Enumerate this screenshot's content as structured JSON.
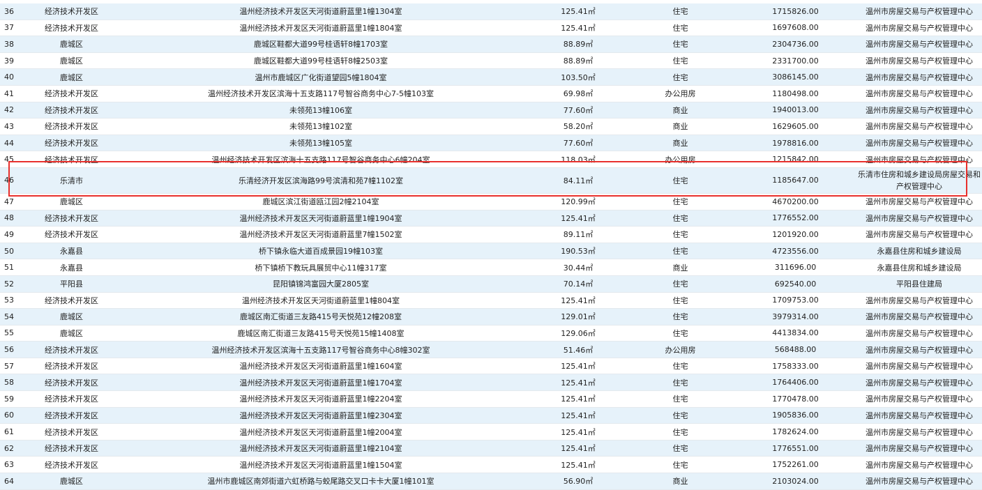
{
  "table": {
    "rows": [
      {
        "no": "36",
        "district": "经济技术开发区",
        "address": "温州经济技术开发区天河街道蔚蓝里1幢1304室",
        "area": "125.41㎡",
        "use": "住宅",
        "price": "1715826.00",
        "org": "温州市房屋交易与产权管理中心"
      },
      {
        "no": "37",
        "district": "经济技术开发区",
        "address": "温州经济技术开发区天河街道蔚蓝里1幢1804室",
        "area": "125.41㎡",
        "use": "住宅",
        "price": "1697608.00",
        "org": "温州市房屋交易与产权管理中心"
      },
      {
        "no": "38",
        "district": "鹿城区",
        "address": "鹿城区鞋都大道99号桂语轩8幢1703室",
        "area": "88.89㎡",
        "use": "住宅",
        "price": "2304736.00",
        "org": "温州市房屋交易与产权管理中心"
      },
      {
        "no": "39",
        "district": "鹿城区",
        "address": "鹿城区鞋都大道99号桂语轩8幢2503室",
        "area": "88.89㎡",
        "use": "住宅",
        "price": "2331700.00",
        "org": "温州市房屋交易与产权管理中心"
      },
      {
        "no": "40",
        "district": "鹿城区",
        "address": "温州市鹿城区广化街道望园5幢1804室",
        "area": "103.50㎡",
        "use": "住宅",
        "price": "3086145.00",
        "org": "温州市房屋交易与产权管理中心"
      },
      {
        "no": "41",
        "district": "经济技术开发区",
        "address": "温州经济技术开发区滨海十五支路117号智谷商务中心7-5幢103室",
        "area": "69.98㎡",
        "use": "办公用房",
        "price": "1180498.00",
        "org": "温州市房屋交易与产权管理中心"
      },
      {
        "no": "42",
        "district": "经济技术开发区",
        "address": "未领苑13幢106室",
        "area": "77.60㎡",
        "use": "商业",
        "price": "1940013.00",
        "org": "温州市房屋交易与产权管理中心"
      },
      {
        "no": "43",
        "district": "经济技术开发区",
        "address": "未领苑13幢102室",
        "area": "58.20㎡",
        "use": "商业",
        "price": "1629605.00",
        "org": "温州市房屋交易与产权管理中心"
      },
      {
        "no": "44",
        "district": "经济技术开发区",
        "address": "未领苑13幢105室",
        "area": "77.60㎡",
        "use": "商业",
        "price": "1978816.00",
        "org": "温州市房屋交易与产权管理中心"
      },
      {
        "no": "45",
        "district": "经济技术开发区",
        "address": "温州经济技术开发区滨海十五支路117号智谷商务中心6幢204室",
        "area": "118.03㎡",
        "use": "办公用房",
        "price": "1215842.00",
        "org": "温州市房屋交易与产权管理中心"
      },
      {
        "no": "46",
        "district": "乐清市",
        "address": "乐清经济开发区滨海路99号滨清和苑7幢1102室",
        "area": "84.11㎡",
        "use": "住宅",
        "price": "1185647.00",
        "org": "乐清市住房和城乡建设局房屋交易和产权管理中心"
      },
      {
        "no": "47",
        "district": "鹿城区",
        "address": "鹿城区滨江街道瓯江园2幢2104室",
        "area": "120.99㎡",
        "use": "住宅",
        "price": "4670200.00",
        "org": "温州市房屋交易与产权管理中心"
      },
      {
        "no": "48",
        "district": "经济技术开发区",
        "address": "温州经济技术开发区天河街道蔚蓝里1幢1904室",
        "area": "125.41㎡",
        "use": "住宅",
        "price": "1776552.00",
        "org": "温州市房屋交易与产权管理中心"
      },
      {
        "no": "49",
        "district": "经济技术开发区",
        "address": "温州经济技术开发区天河街道蔚蓝里7幢1502室",
        "area": "89.11㎡",
        "use": "住宅",
        "price": "1201920.00",
        "org": "温州市房屋交易与产权管理中心"
      },
      {
        "no": "50",
        "district": "永嘉县",
        "address": "桥下镇永临大道百成景园19幢103室",
        "area": "190.53㎡",
        "use": "住宅",
        "price": "4723556.00",
        "org": "永嘉县住房和城乡建设局"
      },
      {
        "no": "51",
        "district": "永嘉县",
        "address": "桥下镇桥下教玩具展贸中心11幢317室",
        "area": "30.44㎡",
        "use": "商业",
        "price": "311696.00",
        "org": "永嘉县住房和城乡建设局"
      },
      {
        "no": "52",
        "district": "平阳县",
        "address": "昆阳镇锦鸿富园大厦2805室",
        "area": "70.14㎡",
        "use": "住宅",
        "price": "692540.00",
        "org": "平阳县住建局"
      },
      {
        "no": "53",
        "district": "经济技术开发区",
        "address": "温州经济技术开发区天河街道蔚蓝里1幢804室",
        "area": "125.41㎡",
        "use": "住宅",
        "price": "1709753.00",
        "org": "温州市房屋交易与产权管理中心"
      },
      {
        "no": "54",
        "district": "鹿城区",
        "address": "鹿城区南汇街道三友路415号天悦苑12幢208室",
        "area": "129.01㎡",
        "use": "住宅",
        "price": "3979314.00",
        "org": "温州市房屋交易与产权管理中心"
      },
      {
        "no": "55",
        "district": "鹿城区",
        "address": "鹿城区南汇街道三友路415号天悦苑15幢1408室",
        "area": "129.06㎡",
        "use": "住宅",
        "price": "4413834.00",
        "org": "温州市房屋交易与产权管理中心"
      },
      {
        "no": "56",
        "district": "经济技术开发区",
        "address": "温州经济技术开发区滨海十五支路117号智谷商务中心8幢302室",
        "area": "51.46㎡",
        "use": "办公用房",
        "price": "568488.00",
        "org": "温州市房屋交易与产权管理中心"
      },
      {
        "no": "57",
        "district": "经济技术开发区",
        "address": "温州经济技术开发区天河街道蔚蓝里1幢1604室",
        "area": "125.41㎡",
        "use": "住宅",
        "price": "1758333.00",
        "org": "温州市房屋交易与产权管理中心"
      },
      {
        "no": "58",
        "district": "经济技术开发区",
        "address": "温州经济技术开发区天河街道蔚蓝里1幢1704室",
        "area": "125.41㎡",
        "use": "住宅",
        "price": "1764406.00",
        "org": "温州市房屋交易与产权管理中心"
      },
      {
        "no": "59",
        "district": "经济技术开发区",
        "address": "温州经济技术开发区天河街道蔚蓝里1幢2204室",
        "area": "125.41㎡",
        "use": "住宅",
        "price": "1770478.00",
        "org": "温州市房屋交易与产权管理中心"
      },
      {
        "no": "60",
        "district": "经济技术开发区",
        "address": "温州经济技术开发区天河街道蔚蓝里1幢2304室",
        "area": "125.41㎡",
        "use": "住宅",
        "price": "1905836.00",
        "org": "温州市房屋交易与产权管理中心"
      },
      {
        "no": "61",
        "district": "经济技术开发区",
        "address": "温州经济技术开发区天河街道蔚蓝里1幢2004室",
        "area": "125.41㎡",
        "use": "住宅",
        "price": "1782624.00",
        "org": "温州市房屋交易与产权管理中心"
      },
      {
        "no": "62",
        "district": "经济技术开发区",
        "address": "温州经济技术开发区天河街道蔚蓝里1幢2104室",
        "area": "125.41㎡",
        "use": "住宅",
        "price": "1776551.00",
        "org": "温州市房屋交易与产权管理中心"
      },
      {
        "no": "63",
        "district": "经济技术开发区",
        "address": "温州经济技术开发区天河街道蔚蓝里1幢1504室",
        "area": "125.41㎡",
        "use": "住宅",
        "price": "1752261.00",
        "org": "温州市房屋交易与产权管理中心"
      },
      {
        "no": "64",
        "district": "鹿城区",
        "address": "温州市鹿城区南郊街道六虹桥路与蛟尾路交叉口卡卡大厦1幢101室",
        "area": "56.90㎡",
        "use": "商业",
        "price": "2103024.00",
        "org": "温州市房屋交易与产权管理中心"
      }
    ]
  },
  "colors": {
    "row_alt": "#e6f2fa",
    "row_plain": "#ffffff",
    "highlight_border": "#e8302c"
  }
}
